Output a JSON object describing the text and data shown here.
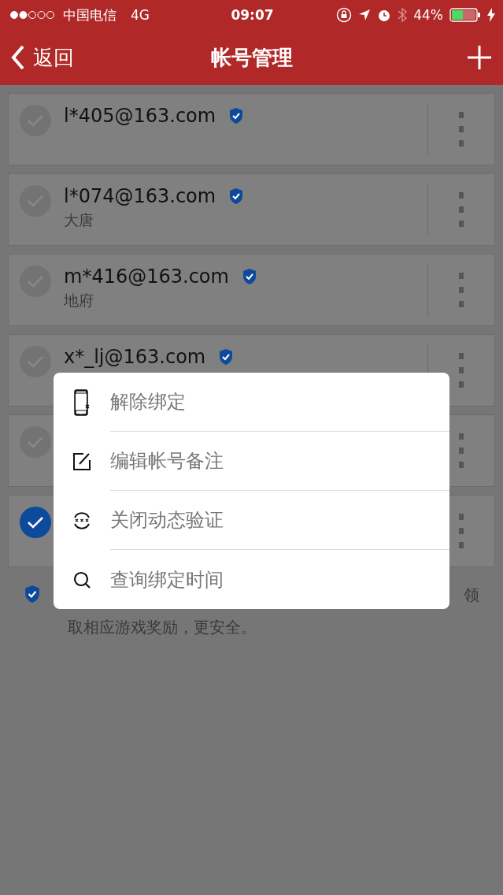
{
  "status_bar": {
    "carrier": "中国电信",
    "network": "4G",
    "time": "09:07",
    "battery": "44%"
  },
  "nav": {
    "back": "返回",
    "title": "帐号管理"
  },
  "accounts": [
    {
      "email": "l*405@163.com",
      "verified": true,
      "selected": false
    },
    {
      "email": "l*074@163.com",
      "note": "大唐",
      "verified": true,
      "selected": false
    },
    {
      "email": "m*416@163.com",
      "note": "地府",
      "verified": true,
      "selected": false
    },
    {
      "email": "x*_lj@163.com",
      "verified": true,
      "selected": false
    },
    {
      "selected": false
    },
    {
      "selected": true
    }
  ],
  "notice": {
    "line_1_tail": "领",
    "line_2": "取相应游戏奖励，更安全。"
  },
  "menu": [
    {
      "kind": "unbind",
      "label": "解除绑定"
    },
    {
      "kind": "edit",
      "label": "编辑帐号备注"
    },
    {
      "kind": "otp",
      "label": "关闭动态验证"
    },
    {
      "kind": "search",
      "label": "查询绑定时间"
    }
  ]
}
